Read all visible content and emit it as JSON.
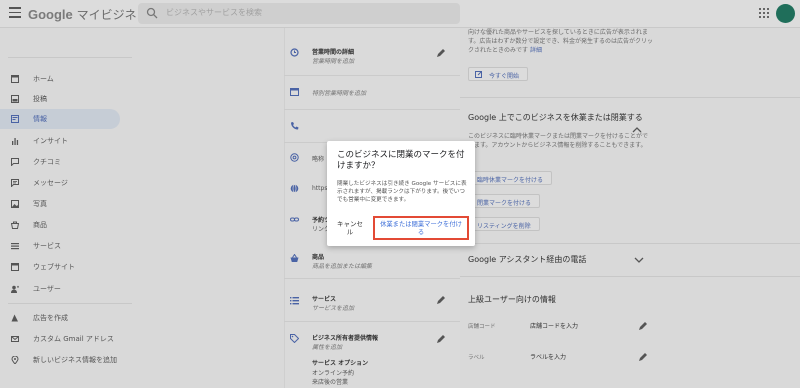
{
  "header": {
    "logo_brand": "Google",
    "logo_product": "マイビジネス",
    "search_placeholder": "ビジネスやサービスを検索",
    "apps_icon": "apps-grid-icon",
    "avatar_color": "#1f6e5a"
  },
  "sidebar": {
    "items": [
      {
        "label": "ホーム",
        "icon": "home-icon"
      },
      {
        "label": "投稿",
        "icon": "post-icon"
      },
      {
        "label": "情報",
        "icon": "info-icon",
        "active": true
      },
      {
        "label": "インサイト",
        "icon": "insights-icon"
      },
      {
        "label": "クチコミ",
        "icon": "reviews-icon"
      },
      {
        "label": "メッセージ",
        "icon": "message-icon"
      },
      {
        "label": "写真",
        "icon": "photo-icon"
      },
      {
        "label": "商品",
        "icon": "products-icon"
      },
      {
        "label": "サービス",
        "icon": "services-icon"
      },
      {
        "label": "ウェブサイト",
        "icon": "website-icon"
      },
      {
        "label": "ユーザー",
        "icon": "users-icon"
      },
      {
        "label": "広告を作成",
        "icon": "ads-icon"
      },
      {
        "label": "カスタム Gmail アドレス",
        "icon": "gmail-icon"
      },
      {
        "label": "新しいビジネス情報を追加",
        "icon": "add-location-icon"
      }
    ]
  },
  "info": {
    "hours_title": "営業時間の詳細",
    "hours_sub": "営業時間を追加",
    "special_hours": "特別営業時間を追加",
    "contact_title": "",
    "name_partial": "略称",
    "url_partial": "https",
    "reservation_title": "予約ツ",
    "reservation_line": "リンク",
    "products_title": "商品",
    "products_sub": "商品を追加または編集",
    "services_title": "サービス",
    "services_sub": "サービスを追加",
    "attributes_title": "ビジネス所有者提供情報",
    "attributes_sub": "属性を追加",
    "service_options_title": "サービス オプション",
    "service_options_line1": "オンライン予約",
    "service_options_line2": "来店後の営業"
  },
  "right": {
    "ad_text": "向けな優れた商品やサービスを探しているときに広告が表示されます。広告はわずか数分で設定でき、料金が発生するのは広告がクリックされたときのみです",
    "ad_link": "詳細",
    "ad_button": "今すぐ開始",
    "close_heading": "Google 上でこのビジネスを休業または閉業する",
    "close_text": "このビジネスに臨時休業マークまたは閉業マークを付けることができます。アカウントからビジネス情報を削除することもできます。",
    "temp_close_button": "臨時休業マークを付ける",
    "closed_button": "閉業マークを付ける",
    "remove_button": "リスティングを削除",
    "assistant_heading": "Google アシスタント経由の電話",
    "advanced_heading": "上級ユーザー向けの情報",
    "store_code_label": "店舗コード",
    "store_code_value": "店舗コードを入力",
    "labels_label": "ラベル",
    "labels_value": "ラベルを入力"
  },
  "dialog": {
    "title": "このビジネスに閉業のマークを付けますか？",
    "body": "閉業したビジネスは引き続き Google サービスに表示されますが、掲載ランクは下がります。後でいつでも営業中に変更できます。",
    "cancel_label": "キャンセル",
    "confirm_label": "休業または閉業マークを付ける",
    "confirm_border_color": "#e34a35",
    "confirm_text_color": "#3c6ed8"
  }
}
